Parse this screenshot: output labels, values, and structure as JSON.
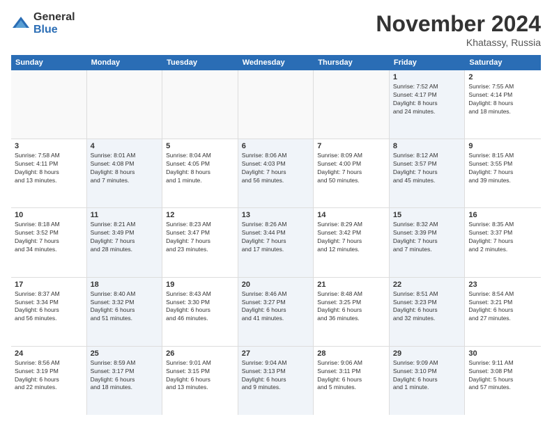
{
  "logo": {
    "general": "General",
    "blue": "Blue"
  },
  "title": "November 2024",
  "location": "Khatassy, Russia",
  "days_of_week": [
    "Sunday",
    "Monday",
    "Tuesday",
    "Wednesday",
    "Thursday",
    "Friday",
    "Saturday"
  ],
  "weeks": [
    [
      {
        "day": "",
        "info": "",
        "empty": true
      },
      {
        "day": "",
        "info": "",
        "empty": true
      },
      {
        "day": "",
        "info": "",
        "empty": true
      },
      {
        "day": "",
        "info": "",
        "empty": true
      },
      {
        "day": "",
        "info": "",
        "empty": true
      },
      {
        "day": "1",
        "info": "Sunrise: 7:52 AM\nSunset: 4:17 PM\nDaylight: 8 hours\nand 24 minutes.",
        "shaded": true
      },
      {
        "day": "2",
        "info": "Sunrise: 7:55 AM\nSunset: 4:14 PM\nDaylight: 8 hours\nand 18 minutes.",
        "shaded": false
      }
    ],
    [
      {
        "day": "3",
        "info": "Sunrise: 7:58 AM\nSunset: 4:11 PM\nDaylight: 8 hours\nand 13 minutes.",
        "shaded": false
      },
      {
        "day": "4",
        "info": "Sunrise: 8:01 AM\nSunset: 4:08 PM\nDaylight: 8 hours\nand 7 minutes.",
        "shaded": true
      },
      {
        "day": "5",
        "info": "Sunrise: 8:04 AM\nSunset: 4:05 PM\nDaylight: 8 hours\nand 1 minute.",
        "shaded": false
      },
      {
        "day": "6",
        "info": "Sunrise: 8:06 AM\nSunset: 4:03 PM\nDaylight: 7 hours\nand 56 minutes.",
        "shaded": true
      },
      {
        "day": "7",
        "info": "Sunrise: 8:09 AM\nSunset: 4:00 PM\nDaylight: 7 hours\nand 50 minutes.",
        "shaded": false
      },
      {
        "day": "8",
        "info": "Sunrise: 8:12 AM\nSunset: 3:57 PM\nDaylight: 7 hours\nand 45 minutes.",
        "shaded": true
      },
      {
        "day": "9",
        "info": "Sunrise: 8:15 AM\nSunset: 3:55 PM\nDaylight: 7 hours\nand 39 minutes.",
        "shaded": false
      }
    ],
    [
      {
        "day": "10",
        "info": "Sunrise: 8:18 AM\nSunset: 3:52 PM\nDaylight: 7 hours\nand 34 minutes.",
        "shaded": false
      },
      {
        "day": "11",
        "info": "Sunrise: 8:21 AM\nSunset: 3:49 PM\nDaylight: 7 hours\nand 28 minutes.",
        "shaded": true
      },
      {
        "day": "12",
        "info": "Sunrise: 8:23 AM\nSunset: 3:47 PM\nDaylight: 7 hours\nand 23 minutes.",
        "shaded": false
      },
      {
        "day": "13",
        "info": "Sunrise: 8:26 AM\nSunset: 3:44 PM\nDaylight: 7 hours\nand 17 minutes.",
        "shaded": true
      },
      {
        "day": "14",
        "info": "Sunrise: 8:29 AM\nSunset: 3:42 PM\nDaylight: 7 hours\nand 12 minutes.",
        "shaded": false
      },
      {
        "day": "15",
        "info": "Sunrise: 8:32 AM\nSunset: 3:39 PM\nDaylight: 7 hours\nand 7 minutes.",
        "shaded": true
      },
      {
        "day": "16",
        "info": "Sunrise: 8:35 AM\nSunset: 3:37 PM\nDaylight: 7 hours\nand 2 minutes.",
        "shaded": false
      }
    ],
    [
      {
        "day": "17",
        "info": "Sunrise: 8:37 AM\nSunset: 3:34 PM\nDaylight: 6 hours\nand 56 minutes.",
        "shaded": false
      },
      {
        "day": "18",
        "info": "Sunrise: 8:40 AM\nSunset: 3:32 PM\nDaylight: 6 hours\nand 51 minutes.",
        "shaded": true
      },
      {
        "day": "19",
        "info": "Sunrise: 8:43 AM\nSunset: 3:30 PM\nDaylight: 6 hours\nand 46 minutes.",
        "shaded": false
      },
      {
        "day": "20",
        "info": "Sunrise: 8:46 AM\nSunset: 3:27 PM\nDaylight: 6 hours\nand 41 minutes.",
        "shaded": true
      },
      {
        "day": "21",
        "info": "Sunrise: 8:48 AM\nSunset: 3:25 PM\nDaylight: 6 hours\nand 36 minutes.",
        "shaded": false
      },
      {
        "day": "22",
        "info": "Sunrise: 8:51 AM\nSunset: 3:23 PM\nDaylight: 6 hours\nand 32 minutes.",
        "shaded": true
      },
      {
        "day": "23",
        "info": "Sunrise: 8:54 AM\nSunset: 3:21 PM\nDaylight: 6 hours\nand 27 minutes.",
        "shaded": false
      }
    ],
    [
      {
        "day": "24",
        "info": "Sunrise: 8:56 AM\nSunset: 3:19 PM\nDaylight: 6 hours\nand 22 minutes.",
        "shaded": false
      },
      {
        "day": "25",
        "info": "Sunrise: 8:59 AM\nSunset: 3:17 PM\nDaylight: 6 hours\nand 18 minutes.",
        "shaded": true
      },
      {
        "day": "26",
        "info": "Sunrise: 9:01 AM\nSunset: 3:15 PM\nDaylight: 6 hours\nand 13 minutes.",
        "shaded": false
      },
      {
        "day": "27",
        "info": "Sunrise: 9:04 AM\nSunset: 3:13 PM\nDaylight: 6 hours\nand 9 minutes.",
        "shaded": true
      },
      {
        "day": "28",
        "info": "Sunrise: 9:06 AM\nSunset: 3:11 PM\nDaylight: 6 hours\nand 5 minutes.",
        "shaded": false
      },
      {
        "day": "29",
        "info": "Sunrise: 9:09 AM\nSunset: 3:10 PM\nDaylight: 6 hours\nand 1 minute.",
        "shaded": true
      },
      {
        "day": "30",
        "info": "Sunrise: 9:11 AM\nSunset: 3:08 PM\nDaylight: 5 hours\nand 57 minutes.",
        "shaded": false
      }
    ]
  ]
}
